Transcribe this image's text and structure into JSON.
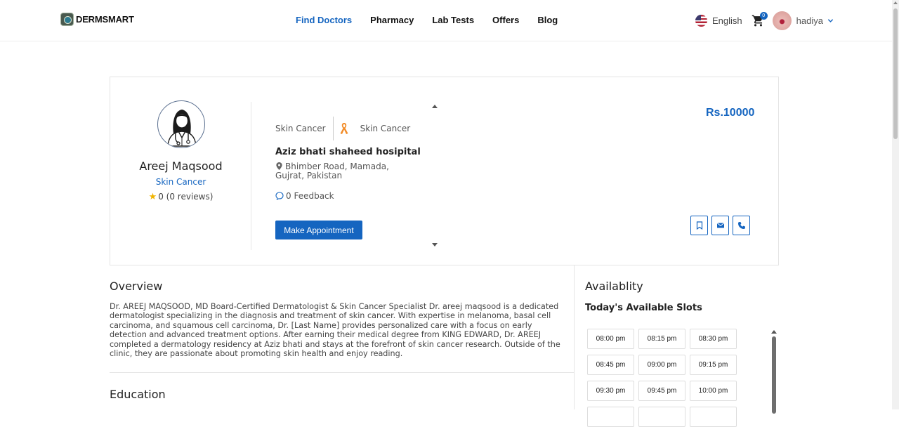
{
  "header": {
    "logo_text": "DERMSMART",
    "nav": [
      "Find Doctors",
      "Pharmacy",
      "Lab Tests",
      "Offers",
      "Blog"
    ],
    "active_nav": "Find Doctors",
    "language": "English",
    "cart_count": "0",
    "username": "hadiya"
  },
  "doctor": {
    "name": "Areej Maqsood",
    "specialty": "Skin Cancer",
    "rating": "0 (0 reviews)",
    "tags": [
      "Skin Cancer",
      "Skin Cancer"
    ],
    "hospital": "Aziz bhati shaheed hosipital",
    "address": "Bhimber Road, Mamada, Gujrat, Pakistan",
    "feedback": "0 Feedback",
    "appointment_button": "Make Appointment",
    "price": "Rs.10000"
  },
  "overview": {
    "title": "Overview",
    "text": "Dr. AREEJ MAQSOOD, MD Board-Certified Dermatologist & Skin Cancer Specialist Dr. areej maqsood is a dedicated dermatologist specializing in the diagnosis and treatment of skin cancer. With expertise in melanoma, basal cell carcinoma, and squamous cell carcinoma, Dr. [Last Name] provides personalized care with a focus on early detection and advanced treatment options. After earning their medical degree from KING EDWARD, Dr. AREEJ completed a dermatology residency at Aziz bhati and stays at the forefront of skin cancer research. Outside of the clinic, they are passionate about promoting skin health and enjoy reading."
  },
  "education": {
    "title": "Education"
  },
  "availability": {
    "title": "Availablity",
    "subtitle": "Today's Available Slots",
    "slots": [
      "08:00 pm",
      "08:15 pm",
      "08:30 pm",
      "08:45 pm",
      "09:00 pm",
      "09:15 pm",
      "09:30 pm",
      "09:45 pm",
      "10:00 pm",
      "",
      "",
      ""
    ]
  },
  "colors": {
    "accent": "#1565c0",
    "ribbon": "#f28c28"
  }
}
